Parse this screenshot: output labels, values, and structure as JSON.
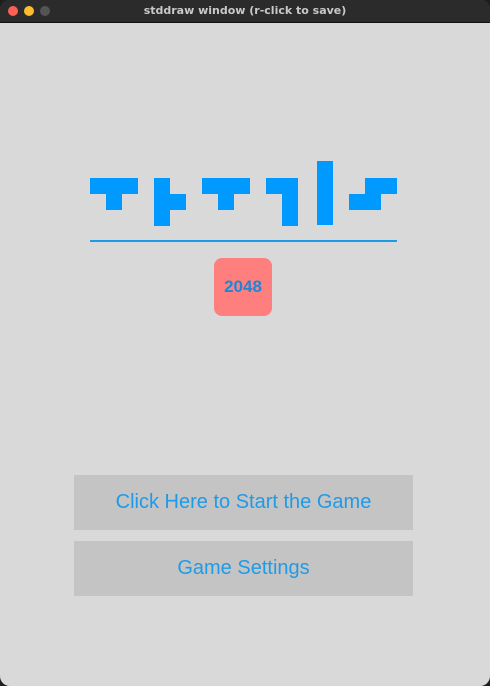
{
  "window": {
    "title": "stddraw window (r-click to save)"
  },
  "logo": {
    "word": "tetris",
    "color": "#0099ff"
  },
  "badge": {
    "text": "2048",
    "background": "#ff7f7f",
    "text_color": "#1e86d8"
  },
  "buttons": {
    "start_label": "Click Here to Start the Game",
    "settings_label": "Game Settings"
  },
  "colors": {
    "canvas": "#d9d9d9",
    "button_bg": "#c4c4c4",
    "accent": "#1e9be8"
  }
}
